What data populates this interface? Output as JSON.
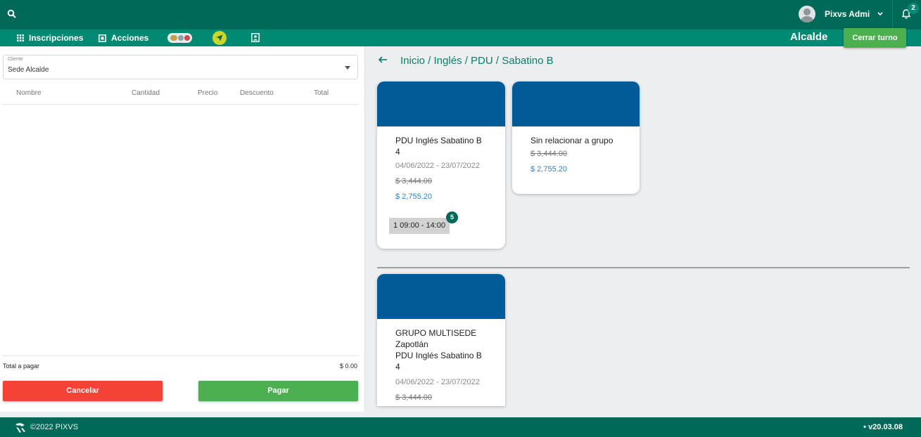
{
  "header": {
    "search_icon": "search-icon",
    "user_name": "Pixvs Admi",
    "notification_count": "2"
  },
  "nav": {
    "items": [
      {
        "label": "Inscripciones",
        "icon": "grid-icon"
      },
      {
        "label": "Acciones",
        "icon": "actions-icon"
      }
    ],
    "sede": "Alcalde",
    "close_shift": "Cerrar turno"
  },
  "left_panel": {
    "client_label": "Cliente",
    "client_value": "Sede Alcalde",
    "columns": [
      "Nombre",
      "Cantidad",
      "Precio",
      "Descuento",
      "Total"
    ],
    "total_label": "Total a pagar",
    "total_value": "$ 0.00",
    "cancel_label": "Cancelar",
    "pay_label": "Pagar"
  },
  "breadcrumb": "Inicio / Inglés / PDU / Sabatino B",
  "cards": [
    {
      "title": "PDU Inglés Sabatino B\n4",
      "dates": "04/06/2022 - 23/07/2022",
      "old_price": "$ 3,444.00",
      "new_price": "$ 2,755.20",
      "schedule": "1 09:00 - 14:00",
      "schedule_count": "5"
    },
    {
      "title": "Sin relacionar a grupo",
      "old_price": "$ 3,444.00",
      "new_price": "$ 2,755.20"
    },
    {
      "title": "GRUPO MULTISEDE\nZapotlán\nPDU Inglés Sabatino B\n4",
      "dates": "04/06/2022 - 23/07/2022",
      "old_price": "$ 3,444.00"
    }
  ],
  "footer": {
    "copyright": "©2022 PIXVS",
    "version": "• v20.03.08"
  },
  "colors": {
    "primary": "#006957",
    "nav": "#008a74",
    "card_header": "#005b96",
    "cancel": "#f44336",
    "pay": "#4caf50",
    "price": "#2f7fd1"
  }
}
